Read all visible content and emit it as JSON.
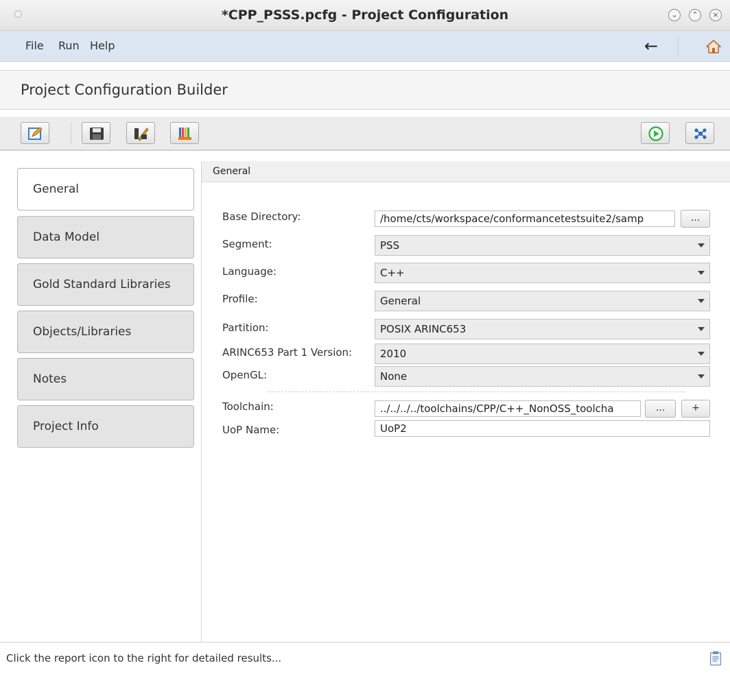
{
  "window": {
    "title": "*CPP_PSSS.pcfg - Project Configuration"
  },
  "menu": {
    "items": [
      "File",
      "Run",
      "Help"
    ]
  },
  "header": {
    "title": "Project Configuration Builder"
  },
  "toolbar": {
    "icons": [
      "edit-icon",
      "save-icon",
      "validate-icon",
      "library-icon",
      "run-icon",
      "settings-icon"
    ],
    "colors": {
      "run": "#39b54a",
      "settings": "#2a6fb8",
      "edit": "#2f7fd1",
      "save": "#3d3d3d"
    }
  },
  "nav": {
    "tabs": [
      {
        "label": "General",
        "active": true
      },
      {
        "label": "Data Model",
        "active": false
      },
      {
        "label": "Gold Standard Libraries",
        "active": false
      },
      {
        "label": "Objects/Libraries",
        "active": false
      },
      {
        "label": "Notes",
        "active": false
      },
      {
        "label": "Project Info",
        "active": false
      }
    ]
  },
  "section": {
    "title": "General"
  },
  "form": {
    "base_directory": {
      "label": "Base Directory:",
      "value": "/home/cts/workspace/conformancetestsuite2/samp",
      "browse": "..."
    },
    "segment": {
      "label": "Segment:",
      "value": "PSS"
    },
    "language": {
      "label": "Language:",
      "value": "C++"
    },
    "profile": {
      "label": "Profile:",
      "value": "General"
    },
    "partition": {
      "label": "Partition:",
      "value": "POSIX ARINC653"
    },
    "arinc_version": {
      "label": "ARINC653 Part 1 Version:",
      "value": "2010"
    },
    "opengl": {
      "label": "OpenGL:",
      "value": "None"
    },
    "toolchain": {
      "label": "Toolchain:",
      "value": "../../../../toolchains/CPP/C++_NonOSS_toolcha",
      "browse": "...",
      "add": "+"
    },
    "uop_name": {
      "label": "UoP Name:",
      "value": "UoP2"
    }
  },
  "status": {
    "text": "Click the report icon to the right for detailed results..."
  }
}
